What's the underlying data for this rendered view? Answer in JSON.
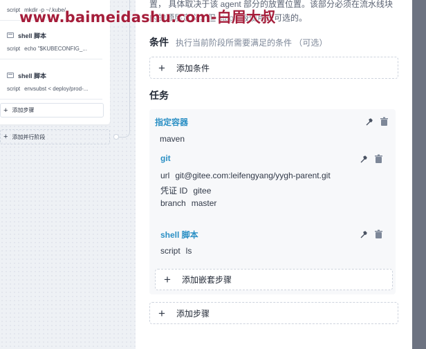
{
  "watermark": "www.baimeidashu.com-白眉大叔",
  "left": {
    "steps": [
      {
        "title": "",
        "key": "script",
        "value": "mkdir -p ~/.kube/"
      },
      {
        "title": "shell 脚本",
        "key": "script",
        "value": "echo \"$KUBECONFIG_..."
      },
      {
        "title": "shell 脚本",
        "key": "script",
        "value": "envsubst < deploy/prod-..."
      }
    ],
    "add_step": "添加步骤",
    "add_parallel": "添加并行阶段"
  },
  "panel": {
    "intro_line1": "置，  具体取决于该 agent 部分的放置位置。该部分必须在流水线块",
    "intro_line2": "内的顶层定义，但 stage 级使用是可选的。",
    "conditions": {
      "title": "条件",
      "desc": "执行当前阶段所需要满足的条件 （可选）",
      "add_label": "添加条件"
    },
    "tasks": {
      "title": "任务",
      "container": {
        "title": "指定容器",
        "value": "maven"
      },
      "git": {
        "title": "git",
        "lines": [
          {
            "key": "url",
            "value": "git@gitee.com:leifengyang/yygh-parent.git"
          },
          {
            "key": "凭证 ID",
            "value": "gitee"
          },
          {
            "key": "branch",
            "value": "master"
          }
        ]
      },
      "shell": {
        "title": "shell 脚本",
        "lines": [
          {
            "key": "script",
            "value": "ls"
          }
        ]
      },
      "add_nested": "添加嵌套步骤",
      "add_step": "添加步骤"
    }
  },
  "icons": {
    "edit": "wrench-icon",
    "delete": "trash-icon",
    "shell": "terminal-icon"
  },
  "colors": {
    "accent": "#2a8fc4",
    "watermark": "#a51d3a",
    "scrollbar": "#6d7381"
  }
}
